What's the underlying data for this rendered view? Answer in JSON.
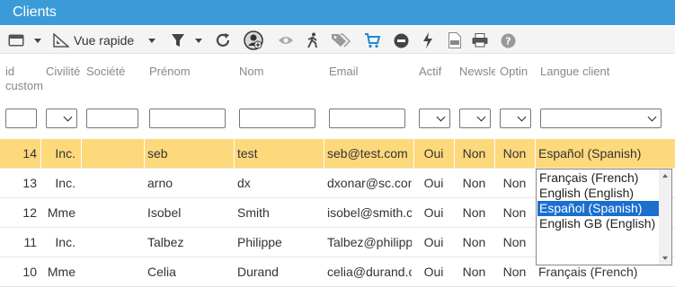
{
  "title": "Clients",
  "toolbar": {
    "quick_view_label": "Vue rapide",
    "icons": [
      "window-icon",
      "quickview-icon",
      "filter-icon",
      "refresh-icon",
      "add-user-icon",
      "eye-icon",
      "walk-icon",
      "tags-icon",
      "cart-icon",
      "minus-circle-icon",
      "bolt-icon",
      "csv-icon",
      "print-icon",
      "help-icon"
    ]
  },
  "columns": {
    "id": "id custom",
    "civilite": "Civilité",
    "societe": "Société",
    "prenom": "Prénom",
    "nom": "Nom",
    "email": "Email",
    "actif": "Actif",
    "newsletter": "Newsle",
    "optin": "Optin",
    "langue": "Langue client"
  },
  "filters": {
    "langue_selected": ""
  },
  "rows": [
    {
      "id": "14",
      "civ": "Inc.",
      "soc": "",
      "prenom": "seb",
      "nom": "test",
      "email": "seb@test.com",
      "actif": "Oui",
      "news": "Non",
      "optin": "Non",
      "langue": "Español (Spanish)"
    },
    {
      "id": "13",
      "civ": "Inc.",
      "soc": "",
      "prenom": "arno",
      "nom": "dx",
      "email": "dxonar@sc.com",
      "actif": "Oui",
      "news": "Non",
      "optin": "Non",
      "langue": ""
    },
    {
      "id": "12",
      "civ": "Mme",
      "soc": "",
      "prenom": "Isobel",
      "nom": "Smith",
      "email": "isobel@smith.com",
      "actif": "Oui",
      "news": "Non",
      "optin": "Non",
      "langue": ""
    },
    {
      "id": "11",
      "civ": "Inc.",
      "soc": "",
      "prenom": "Talbez",
      "nom": "Philippe",
      "email": "Talbez@philippe.com",
      "actif": "Oui",
      "news": "Non",
      "optin": "Non",
      "langue": ""
    },
    {
      "id": "10",
      "civ": "Mme",
      "soc": "",
      "prenom": "Celia",
      "nom": "Durand",
      "email": "celia@durand.com",
      "actif": "Oui",
      "news": "Non",
      "optin": "Non",
      "langue": "Français (French)"
    }
  ],
  "language_dropdown": {
    "options": [
      "Français (French)",
      "English (English)",
      "Español (Spanish)",
      "English GB (English)"
    ],
    "selected": "Español (Spanish)"
  },
  "colors": {
    "title_bar": "#3b9bd9",
    "selected_row": "#fdd97c",
    "active_option": "#1a6fcf",
    "cart_icon": "#1e88d0"
  }
}
